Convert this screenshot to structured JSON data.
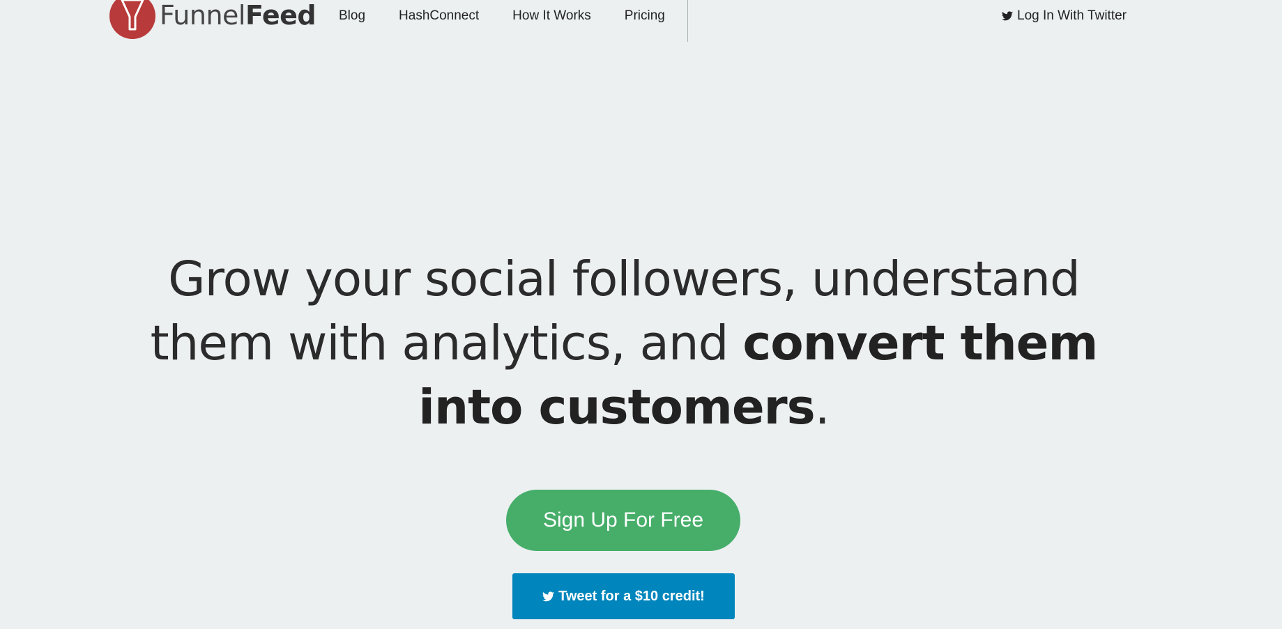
{
  "brand": {
    "name_light": "Funnel",
    "name_bold": "Feed",
    "logo_icon": "funnel-icon",
    "logo_color": "#b83a3a"
  },
  "nav": {
    "links": [
      "Blog",
      "HashConnect",
      "How It Works",
      "Pricing"
    ],
    "login_label": "Log In With Twitter",
    "login_icon": "twitter-bird-icon"
  },
  "hero": {
    "line_part1": "Grow your social followers, understand them with analytics, and ",
    "emphasis": "convert them into customers",
    "end": "."
  },
  "cta": {
    "signup_label": "Sign Up For Free",
    "signup_color": "#47ae6a",
    "tweet_label": "Tweet for a $10 credit!",
    "tweet_icon": "twitter-bird-icon",
    "tweet_color": "#0086bc"
  },
  "colors": {
    "background": "#ecf0f1",
    "text": "#222222"
  }
}
